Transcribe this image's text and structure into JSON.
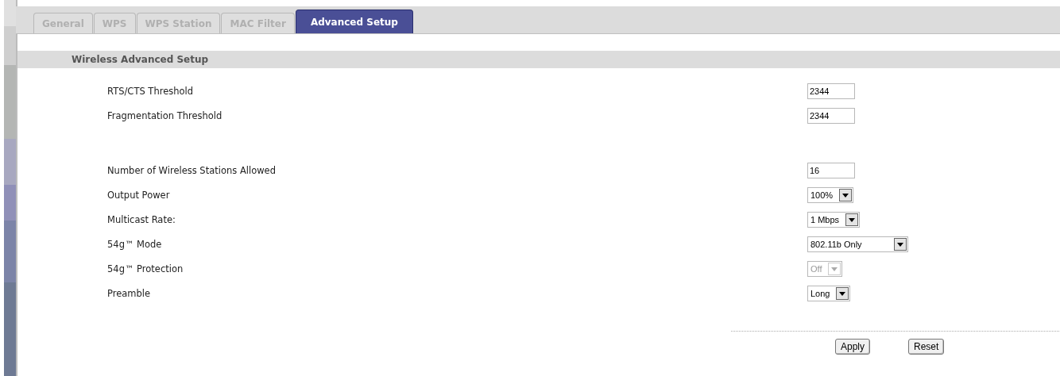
{
  "tabs": [
    {
      "label": "General",
      "selected": false
    },
    {
      "label": "WPS",
      "selected": false
    },
    {
      "label": "WPS Station",
      "selected": false
    },
    {
      "label": "MAC Filter",
      "selected": false
    },
    {
      "label": "Advanced Setup",
      "selected": true
    }
  ],
  "section_title": "Wireless Advanced Setup",
  "groups": [
    {
      "rows": [
        {
          "label": "RTS/CTS  Threshold",
          "kind": "text",
          "value": "2344",
          "disabled": false
        },
        {
          "label": "Fragmentation  Threshold",
          "kind": "text",
          "value": "2344",
          "disabled": false
        }
      ]
    },
    {
      "rows": [
        {
          "label": "Number of Wireless Stations Allowed",
          "kind": "text",
          "value": "16",
          "disabled": false
        },
        {
          "label": "Output Power",
          "kind": "select",
          "value": "100%",
          "disabled": false
        },
        {
          "label": "Multicast Rate:",
          "kind": "select",
          "value": "1 Mbps",
          "disabled": false
        },
        {
          "label": "54g™ Mode",
          "kind": "select",
          "value": "802.11b Only",
          "disabled": false
        },
        {
          "label": "54g™ Protection",
          "kind": "select",
          "value": "Off",
          "disabled": true
        },
        {
          "label": "Preamble",
          "kind": "select",
          "value": "Long",
          "disabled": false
        }
      ]
    }
  ],
  "buttons": [
    "Apply",
    "Reset"
  ]
}
